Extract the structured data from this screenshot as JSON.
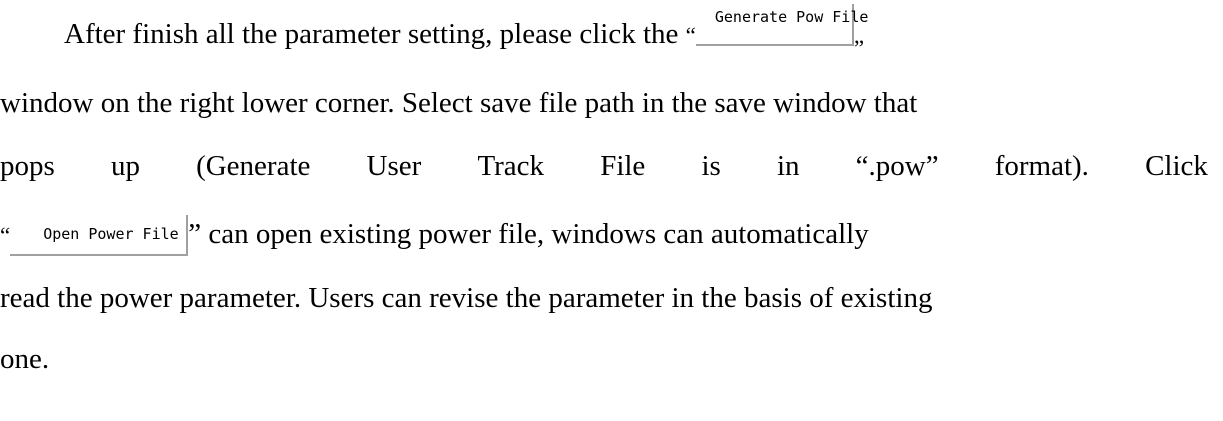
{
  "paragraph": {
    "line1_text": "After finish all the parameter setting, please click the",
    "line1_open_quote": "“",
    "generate_button_label": "Generate Pow File",
    "line1_close_quote": "„",
    "line2_text": "window on the right lower corner. Select save file path in the save window that",
    "line3_words": [
      "pops",
      "up",
      "(Generate",
      "User",
      "Track",
      "File",
      "is",
      "in",
      "“.pow”",
      "format).",
      "Click"
    ],
    "line4_open_quote": "“",
    "open_button_label": "Open Power File",
    "line4_text": "” can open existing power file, windows can automatically",
    "line5_text": "read the power parameter. Users can revise the parameter in the basis of existing",
    "line6_text": "one."
  }
}
